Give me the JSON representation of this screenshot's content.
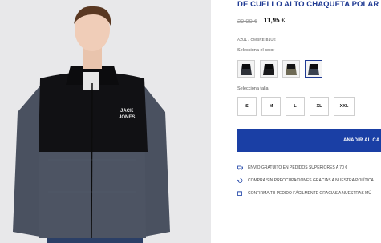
{
  "product": {
    "title": "DE CUELLO ALTO CHAQUETA POLAR",
    "price_old": "29,99 €",
    "price_new": "11,95 €",
    "color_name": "AZUL / OMBRE BLUE",
    "color_label": "Selecciona el color",
    "size_label": "Selecciona talla",
    "chest_logo": "JACK & JONES"
  },
  "colors": [
    {
      "name": "negro-azul",
      "body": "#2e3138",
      "yoke": "#0d0d0f"
    },
    {
      "name": "negro",
      "body": "#1b1b1d",
      "yoke": "#0a0a0a"
    },
    {
      "name": "verde-negro",
      "body": "#6e6a55",
      "yoke": "#151515"
    },
    {
      "name": "azul-ombre",
      "body": "#3a4250",
      "yoke": "#0d0d0f"
    }
  ],
  "sizes": [
    "S",
    "M",
    "L",
    "XL",
    "XXL"
  ],
  "cart": {
    "button": "AÑADIR AL CA"
  },
  "info": [
    {
      "icon": "truck-icon",
      "text": "ENVÍO GRATUITO EN PEDIDOS SUPERIORES A 70 €"
    },
    {
      "icon": "return-icon",
      "text": "COMPRA SIN PREOCUPACIONES GRACIAS A NUESTRA POLÍTICA"
    },
    {
      "icon": "calendar-icon",
      "text": "CONFIRMA TU PEDIDO FÁCILMENTE GRACIAS A NUESTRAS MÚ"
    }
  ],
  "colors_theme": {
    "accent": "#1a3fa5",
    "title": "#1f3a93"
  }
}
